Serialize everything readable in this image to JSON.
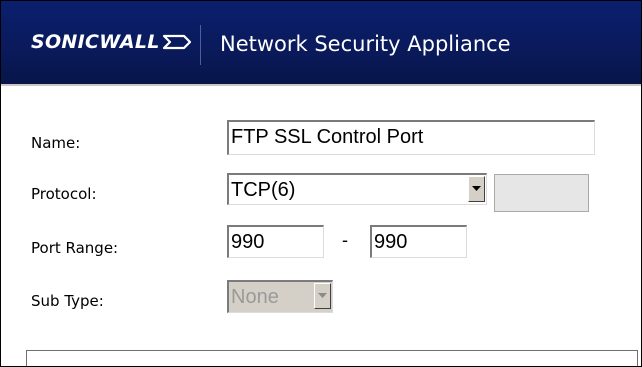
{
  "header": {
    "logo_text": "SONICWALL",
    "product_name": "Network Security Appliance",
    "background_color": "#0a1a5c"
  },
  "form": {
    "name": {
      "label": "Name:",
      "value": "FTP SSL Control Port"
    },
    "protocol": {
      "label": "Protocol:",
      "selected": "TCP(6)",
      "extra_field_value": ""
    },
    "port_range": {
      "label": "Port Range:",
      "start": "990",
      "separator": "-",
      "end": "990"
    },
    "sub_type": {
      "label": "Sub Type:",
      "selected": "None",
      "disabled": true
    }
  }
}
